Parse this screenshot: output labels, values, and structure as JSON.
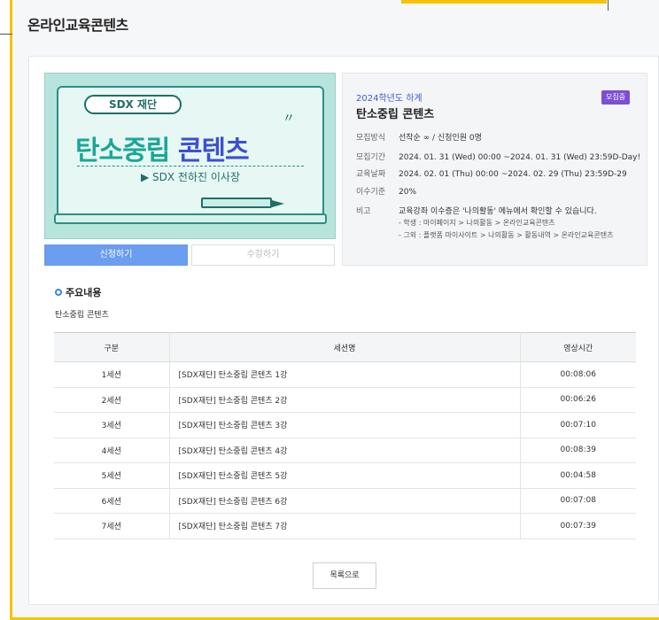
{
  "page": {
    "title": "온라인교육콘텐츠"
  },
  "thumbnail": {
    "pill": "SDX 재단",
    "title_part1": "탄소중립",
    "title_part2": "콘텐츠",
    "subtitle": "▶ SDX 전하진 이사장"
  },
  "actions": {
    "apply": "신청하기",
    "take": "수강하기",
    "list": "목록으로"
  },
  "info": {
    "year": "2024학년도 하계",
    "badge": "모집중",
    "title": "탄소중립 콘텐츠",
    "rows": [
      {
        "label": "모집방식",
        "value": "선착순 ∞ / 신청인원 0명"
      },
      {
        "label": "모집기간",
        "value": "2024. 01. 31 (Wed) 00:00 ~2024. 01. 31 (Wed) 23:59D-Day!"
      },
      {
        "label": "교육날짜",
        "value": "2024. 02. 01 (Thu) 00:00 ~2024. 02. 29 (Thu) 23:59D-29"
      },
      {
        "label": "이수기준",
        "value": "20%"
      },
      {
        "label": "비고",
        "value": "교육강좌 이수증은 '나의활동' 메뉴에서 확인할 수 있습니다."
      }
    ],
    "notes": [
      "- 학생 : 마이페이지 > 나의활동 > 온라인교육콘텐츠",
      "- 그외 : 플랫폼 마이사이트 > 나의활동 > 활동내역 > 온라인교육콘텐츠"
    ]
  },
  "section": {
    "heading": "주요내용",
    "subtitle": "탄소중립 콘텐츠"
  },
  "table": {
    "headers": [
      "구분",
      "세션명",
      "영상시간"
    ],
    "rows": [
      [
        "1세션",
        "[SDX재단] 탄소중립 콘텐츠 1강",
        "00:08:06"
      ],
      [
        "2세션",
        "[SDX재단] 탄소중립 콘텐츠 2강",
        "00:06:26"
      ],
      [
        "3세션",
        "[SDX재단] 탄소중립 콘텐츠 3강",
        "00:07:10"
      ],
      [
        "4세션",
        "[SDX재단] 탄소중립 콘텐츠 4강",
        "00:08:39"
      ],
      [
        "5세션",
        "[SDX재단] 탄소중립 콘텐츠 5강",
        "00:04:58"
      ],
      [
        "6세션",
        "[SDX재단] 탄소중립 콘텐츠 6강",
        "00:07:08"
      ],
      [
        "7세션",
        "[SDX재단] 탄소중립 콘텐츠 7강",
        "00:07:39"
      ]
    ]
  },
  "colors": {
    "accent": "#f5c300",
    "primary": "#6b9df0",
    "badge": "#7b4fd6",
    "link": "#3b5bdb"
  }
}
